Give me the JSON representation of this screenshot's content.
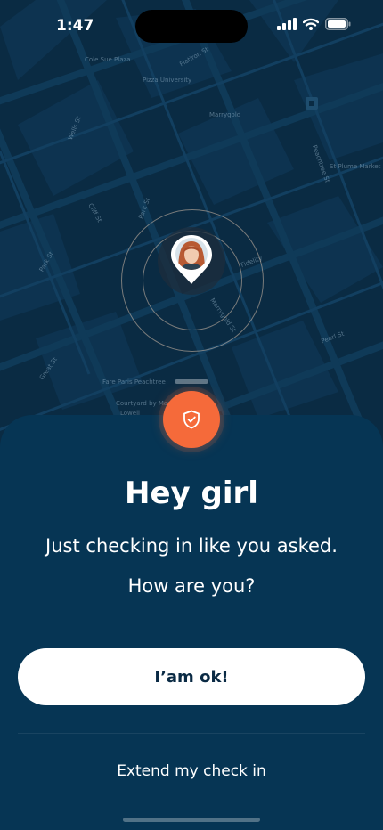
{
  "status_bar": {
    "time": "1:47",
    "icons": [
      "signal-icon",
      "wifi-icon",
      "battery-icon"
    ]
  },
  "map": {
    "labels": [
      "Cole Sue Plaza",
      "Flatiron St",
      "Pizza University",
      "Marrygold",
      "St Plume Market",
      "Peachtree St",
      "Marrygold St",
      "Wells St",
      "Park St",
      "Pearl St",
      "Great St",
      "Cliff St",
      "Park St",
      "Fidelity",
      "Fare Paris Peachtree",
      "Courtyard by Marriott",
      "Lowell"
    ]
  },
  "user_avatar": "avatar",
  "sheet": {
    "icon": "shield-check-icon",
    "title": "Hey girl",
    "message_line1": "Just checking in like you asked.",
    "message_line2": "How are you?",
    "ok_button": "I’am ok!",
    "extend_link": "Extend my check in"
  },
  "colors": {
    "accent": "#f56a3a",
    "sheet_bg": "#063554",
    "map_bg": "#0a2b43",
    "button_bg": "#ffffff",
    "button_text": "#0a2a44"
  }
}
